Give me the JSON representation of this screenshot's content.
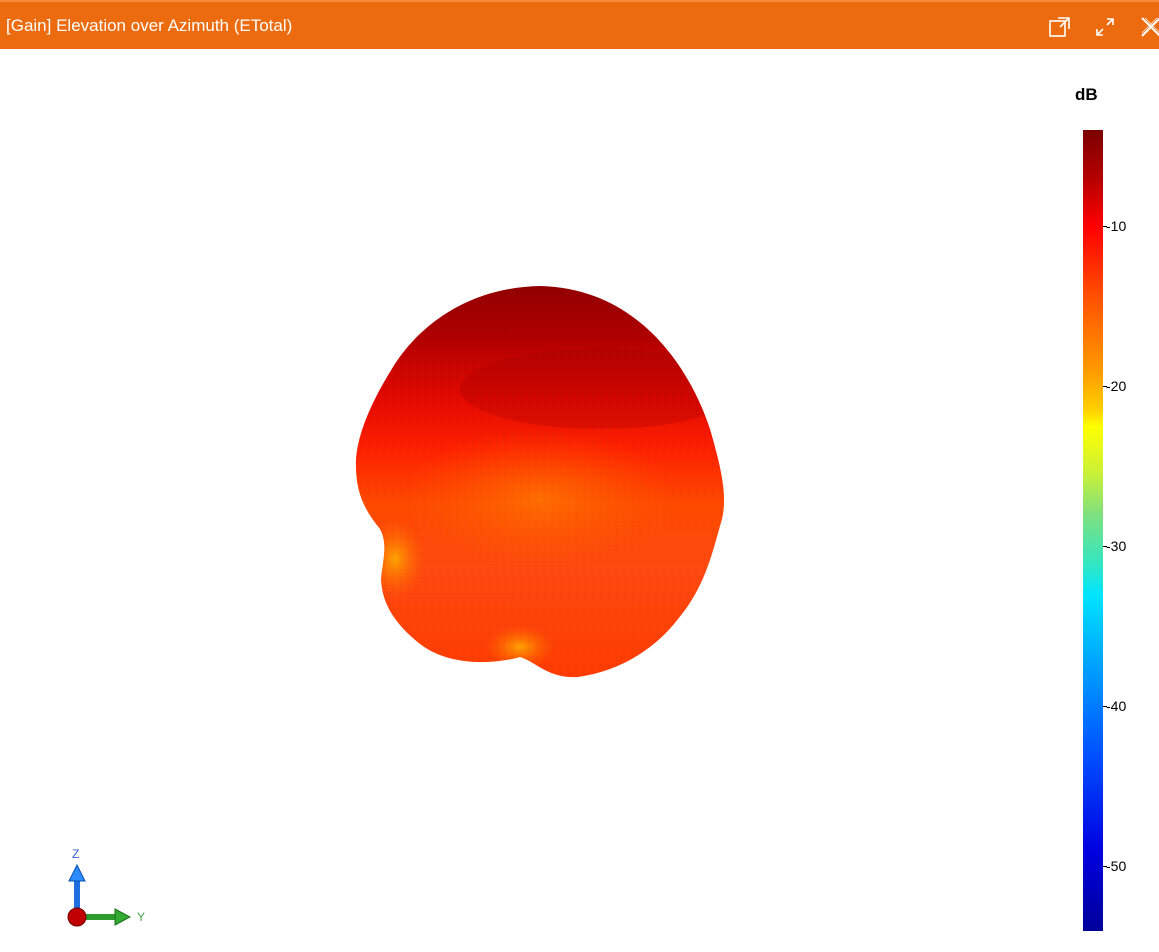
{
  "window": {
    "title": "[Gain] Elevation over Azimuth (ETotal)",
    "controls": [
      {
        "name": "undock-icon",
        "label": "undock"
      },
      {
        "name": "maximize-icon",
        "label": "maximize"
      },
      {
        "name": "close-icon",
        "label": "close"
      }
    ],
    "accent_color": "#eb6b0e"
  },
  "plot": {
    "type": "3d-radiation-pattern",
    "axes": {
      "z_label": "Z",
      "y_label": "Y"
    }
  },
  "colorbar": {
    "unit": "dB",
    "ticks": [
      "-10",
      "-20",
      "-30",
      "-40",
      "-50"
    ],
    "range": [
      -55,
      -5
    ]
  }
}
